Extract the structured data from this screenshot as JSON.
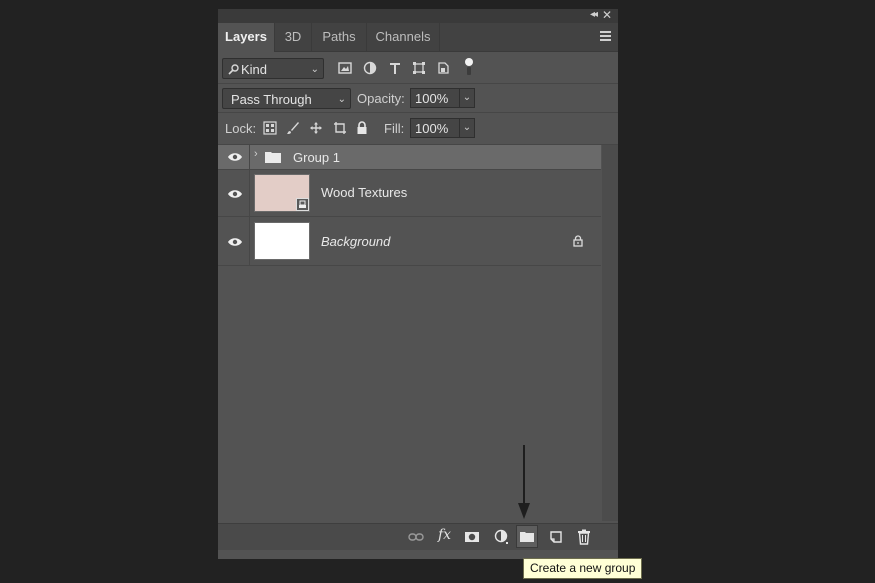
{
  "tabs": [
    "Layers",
    "3D",
    "Paths",
    "Channels"
  ],
  "filter": {
    "kind_label": "Kind"
  },
  "blend": {
    "mode": "Pass Through",
    "opacity_label": "Opacity:",
    "opacity_value": "100%"
  },
  "lock": {
    "label": "Lock:",
    "fill_label": "Fill:",
    "fill_value": "100%"
  },
  "layers": [
    {
      "name": "Group 1",
      "type": "group",
      "selected": true
    },
    {
      "name": "Wood Textures",
      "type": "smart-object"
    },
    {
      "name": "Background",
      "type": "background",
      "locked": true
    }
  ],
  "tooltip": "Create a new group",
  "colors": {
    "background": "#222222",
    "panel": "#535353",
    "selected_layer": "#6a6a6a",
    "tooltip_bg": "#ffffd6"
  }
}
